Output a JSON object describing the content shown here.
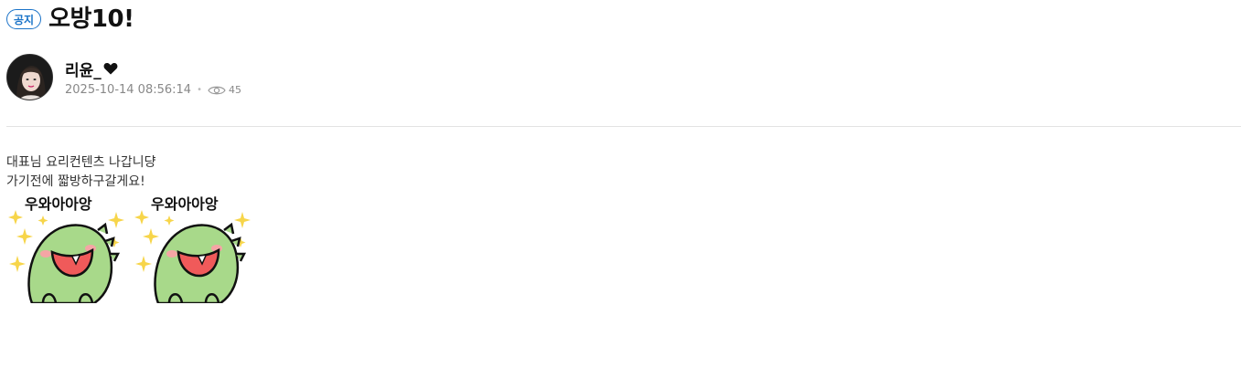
{
  "post": {
    "badge": "공지",
    "title": "오방10!"
  },
  "author": {
    "name": "리윤_",
    "heart_icon": "black-heart-icon",
    "date": "2025-10-14 08:56:14",
    "view_icon": "eye-icon",
    "views": "45"
  },
  "body": {
    "line1": "대표님 요리컨텐츠 나갑니댱",
    "line2": "가기전에 짧방하구갈게요!"
  },
  "stickers": [
    {
      "caption": "우와아아앙",
      "icon": "green-dino-sticker"
    },
    {
      "caption": "우와아아앙",
      "icon": "green-dino-sticker"
    }
  ],
  "colors": {
    "accent": "#1a73c8",
    "dino_green": "#a8d98a",
    "sparkle_yellow": "#f7d54a"
  }
}
